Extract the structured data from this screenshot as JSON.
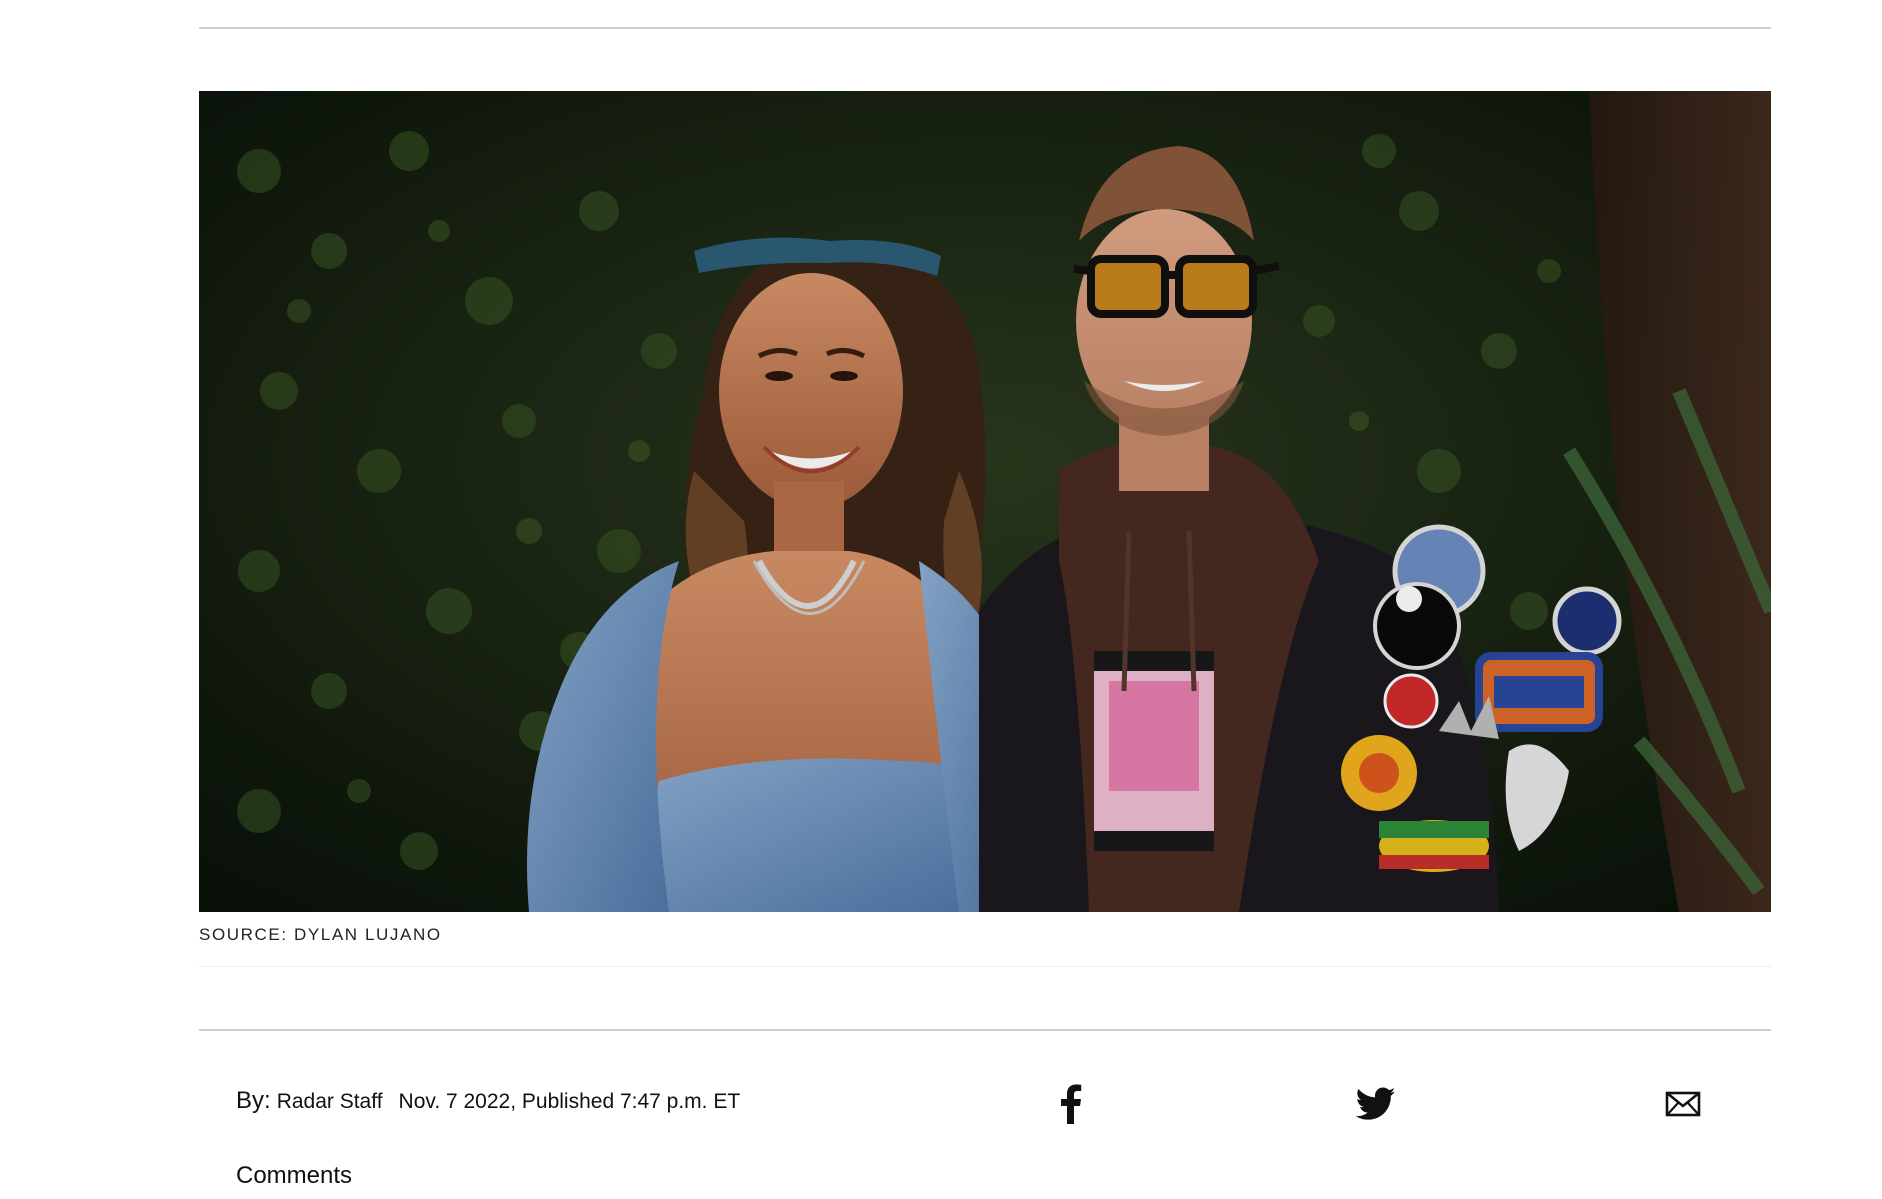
{
  "hero_image": {
    "alt": "",
    "caption": "SOURCE: DYLAN LUJANO"
  },
  "byline": {
    "by_label": "By:",
    "author": "Radar Staff",
    "date": "Nov. 7 2022, Published 7:47 p.m. ET"
  },
  "share": {
    "facebook_icon": "facebook-icon",
    "twitter_icon": "twitter-icon",
    "email_icon": "mail-icon"
  },
  "comments_label": "Comments",
  "colors": {
    "rule": "#cfcfcf",
    "text": "#111111",
    "background": "#ffffff"
  }
}
